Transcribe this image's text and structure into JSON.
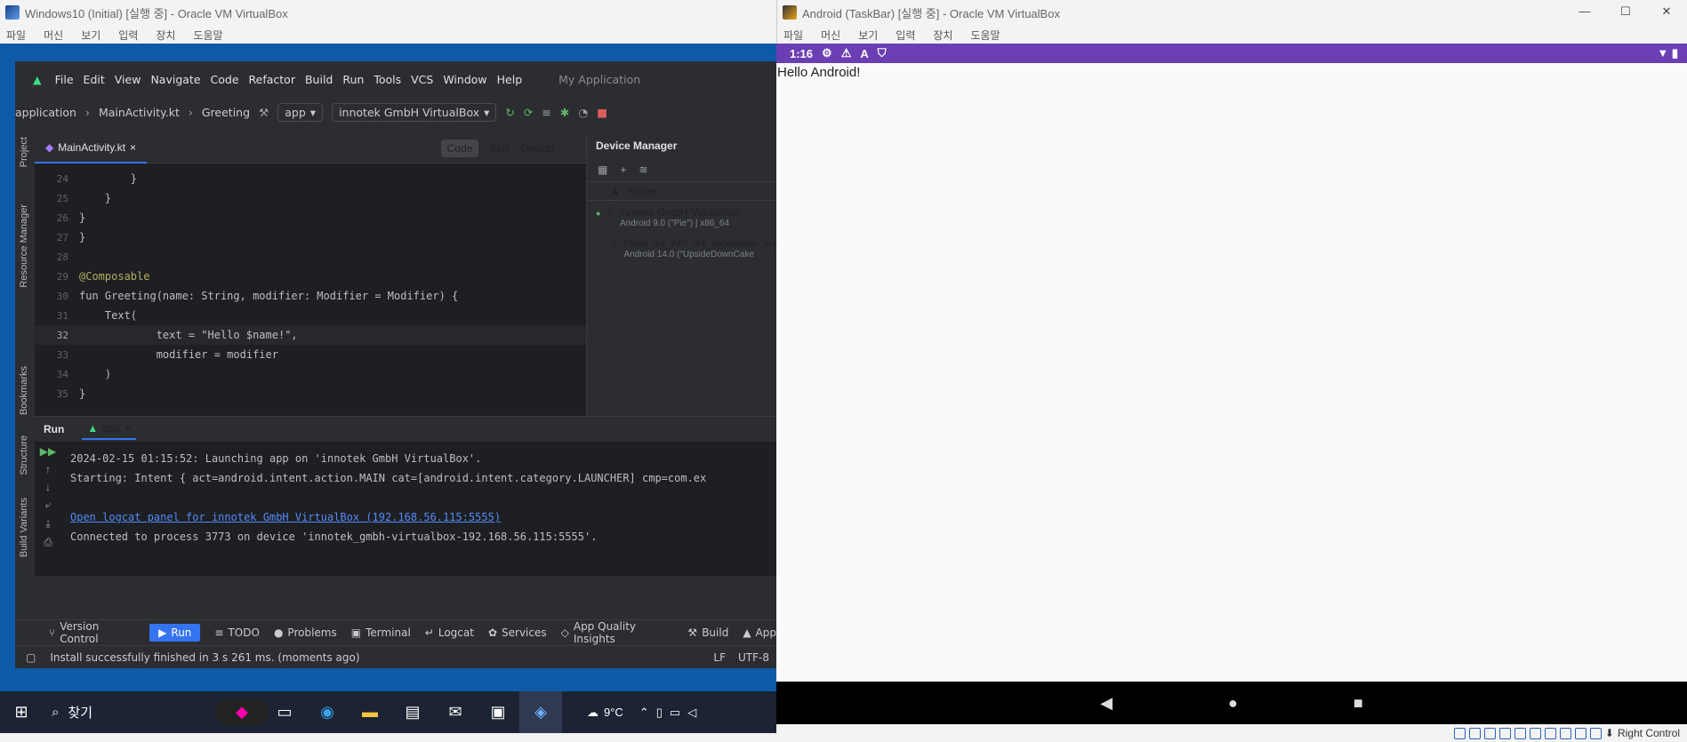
{
  "left_window": {
    "title": "Windows10 (Initial) [실행 중] - Oracle VM VirtualBox",
    "menu": [
      "파일",
      "머신",
      "보기",
      "입력",
      "장치",
      "도움말"
    ]
  },
  "studio": {
    "menu": [
      "File",
      "Edit",
      "View",
      "Navigate",
      "Code",
      "Refactor",
      "Build",
      "Run",
      "Tools",
      "VCS",
      "Window",
      "Help"
    ],
    "project_name": "My Application",
    "breadcrumb": [
      "application",
      "MainActivity.kt",
      "Greeting"
    ],
    "run_config": "app",
    "device": "innotek GmbH VirtualBox",
    "left_tools": [
      "Project",
      "Resource Manager",
      "Bookmarks",
      "Structure",
      "Build Variants"
    ],
    "tab": "MainActivity.kt",
    "view_modes": [
      "Code",
      "Split",
      "Design"
    ],
    "code_lines": [
      {
        "n": "24",
        "t": "        }"
      },
      {
        "n": "25",
        "t": "    }"
      },
      {
        "n": "26",
        "t": "}"
      },
      {
        "n": "27",
        "t": "}"
      },
      {
        "n": "28",
        "t": ""
      },
      {
        "n": "29",
        "t": "@Composable"
      },
      {
        "n": "30",
        "t": "fun Greeting(name: String, modifier: Modifier = Modifier) {"
      },
      {
        "n": "31",
        "t": "    Text("
      },
      {
        "n": "32",
        "t": "            text = \"Hello $name!\","
      },
      {
        "n": "33",
        "t": "            modifier = modifier"
      },
      {
        "n": "34",
        "t": "    )"
      },
      {
        "n": "35",
        "t": "}"
      }
    ],
    "device_manager": {
      "title": "Device Manager",
      "column": "Name",
      "devices": [
        {
          "name": "innotek GmbH VirtualBox",
          "detail": "Android 9.0 (\"Pie\") | x86_64"
        },
        {
          "name": "Pixel_3a_API_34_extension_leve",
          "detail": "Android 14.0 (\"UpsideDownCake"
        }
      ]
    },
    "run": {
      "label": "Run",
      "tab": "app",
      "output": [
        "2024-02-15 01:15:52: Launching app on 'innotek GmbH VirtualBox'.",
        "Starting: Intent { act=android.intent.action.MAIN cat=[android.intent.category.LAUNCHER] cmp=com.ex",
        "",
        "Open logcat panel for innotek GmbH VirtualBox (192.168.56.115:5555)",
        "Connected to process 3773 on device 'innotek_gmbh-virtualbox-192.168.56.115:5555'."
      ]
    },
    "bottom_tools": [
      "Version Control",
      "Run",
      "TODO",
      "Problems",
      "Terminal",
      "Logcat",
      "Services",
      "App Quality Insights",
      "Build",
      "App"
    ],
    "status": "Install successfully finished in 3 s 261 ms. (moments ago)",
    "status_right": [
      "LF",
      "UTF-8"
    ]
  },
  "taskbar": {
    "search": "찾기",
    "weather": "9°C"
  },
  "right_window": {
    "title": "Android (TaskBar) [실행 중] - Oracle VM VirtualBox",
    "menu": [
      "파일",
      "머신",
      "보기",
      "입력",
      "장치",
      "도움말"
    ],
    "time": "1:16",
    "app_text": "Hello Android!",
    "host_key": "Right Control"
  }
}
